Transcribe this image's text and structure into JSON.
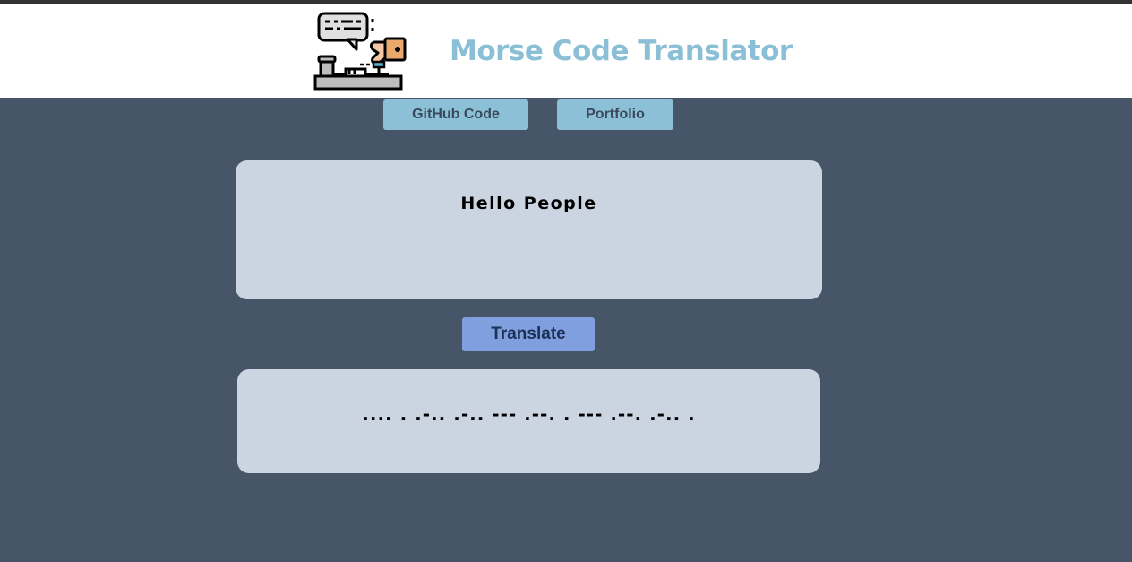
{
  "header": {
    "title": "Morse Code Translator",
    "logo_icon": "morse-telegraph-icon"
  },
  "nav": {
    "github_label": "GitHub Code",
    "portfolio_label": "Portfolio"
  },
  "input": {
    "value": "Hello People"
  },
  "translate": {
    "label": "Translate"
  },
  "output": {
    "value": ".... . .-.. .-.. --- .--. . --- .--. .-.. ."
  },
  "colors": {
    "background": "#475569",
    "header_bg": "#ffffff",
    "title": "#8bbfd6",
    "nav_button": "#8bc0d6",
    "translate_button": "#7f9fdf",
    "panel": "#cbd5e1"
  }
}
